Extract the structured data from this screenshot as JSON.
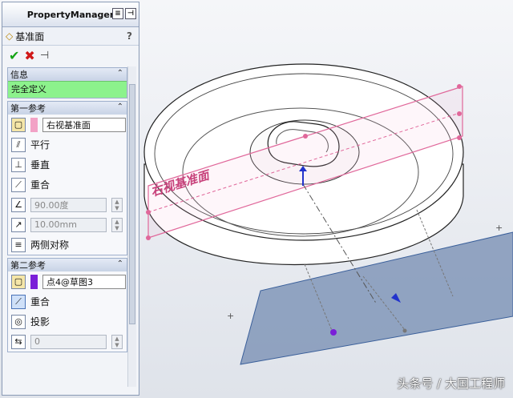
{
  "panel": {
    "title": "PropertyManager",
    "feature_title": "基准面",
    "help": "?",
    "info_section": {
      "header": "信息",
      "status": "完全定义",
      "status_color": "#8cf28c"
    },
    "first_reference": {
      "header": "第一参考",
      "selection": "右视基准面",
      "selection_color": "#f2a2c6",
      "options": [
        "平行",
        "垂直",
        "重合"
      ],
      "angle_value": "90.00度",
      "distance_value": "10.00mm",
      "symmetric_label": "两侧对称"
    },
    "second_reference": {
      "header": "第二参考",
      "selection": "点4@草图3",
      "selection_color": "#7a1fd8",
      "options": [
        "重合",
        "投影"
      ],
      "count_value": "0"
    }
  },
  "viewport": {
    "plane_label": "右视基准面",
    "plane_color": "#e0679a",
    "new_plane_color": "#7f95b6"
  },
  "watermark": "头条号 / 大国工程师"
}
